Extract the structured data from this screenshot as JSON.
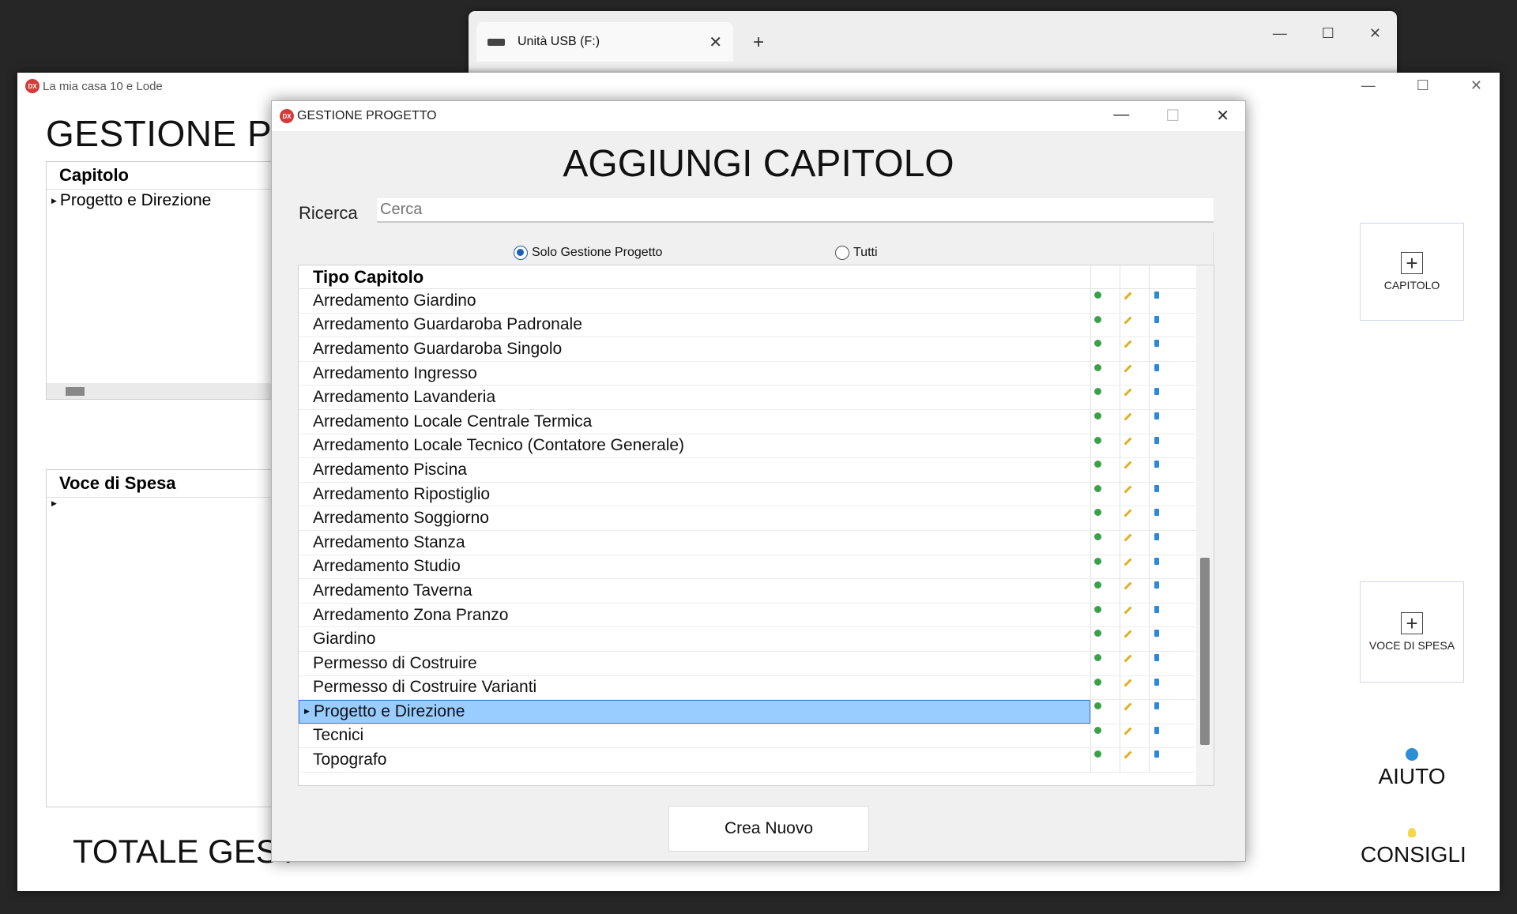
{
  "explorer": {
    "tab_title": "Unità USB (F:)",
    "close_label": "✕",
    "new_tab_label": "+",
    "controls": [
      "—",
      "☐",
      "✕"
    ]
  },
  "main_window": {
    "title": "La mia casa 10 e Lode",
    "controls": [
      "—",
      "☐",
      "✕"
    ],
    "heading": "GESTIONE PR",
    "capitolo_grid": {
      "header": "Capitolo",
      "rows": [
        "Progetto e Direzione"
      ]
    },
    "voce_grid": {
      "header": "Voce di Spesa",
      "rows": [
        ""
      ]
    },
    "capitolo_button": "CAPITOLO",
    "voce_button": "VOCE DI SPESA",
    "aiuto_label": "AIUTO",
    "consigli_label": "CONSIGLI",
    "totale_label": "TOTALE GEST"
  },
  "dialog": {
    "title": "GESTIONE PROGETTO",
    "controls": [
      "—",
      "☐",
      "✕"
    ],
    "heading": "AGGIUNGI CAPITOLO",
    "search_label": "Ricerca",
    "search_placeholder": "Cerca",
    "radio_options": [
      {
        "label": "Solo Gestione Progetto",
        "selected": true
      },
      {
        "label": "Tutti",
        "selected": false
      }
    ],
    "grid_header": "Tipo Capitolo",
    "rows": [
      "Arredamento Giardino",
      "Arredamento Guardaroba Padronale",
      "Arredamento Guardaroba Singolo",
      "Arredamento Ingresso",
      "Arredamento Lavanderia",
      "Arredamento Locale Centrale Termica",
      "Arredamento Locale Tecnico (Contatore Generale)",
      "Arredamento Piscina",
      "Arredamento Ripostiglio",
      "Arredamento Soggiorno",
      "Arredamento Stanza",
      "Arredamento Studio",
      "Arredamento Taverna",
      "Arredamento Zona Pranzo",
      "Giardino",
      "Permesso di Costruire",
      "Permesso di Costruire Varianti",
      "Progetto e Direzione",
      "Tecnici",
      "Topografo"
    ],
    "selected_row": "Progetto e Direzione",
    "action_icons": [
      "check-icon",
      "edit-icon",
      "delete-icon"
    ],
    "create_button": "Crea Nuovo",
    "colors": {
      "selection": "#99ccff",
      "check": "#3aa14a",
      "edit": "#e0b020",
      "delete": "#2a8ad8"
    }
  }
}
